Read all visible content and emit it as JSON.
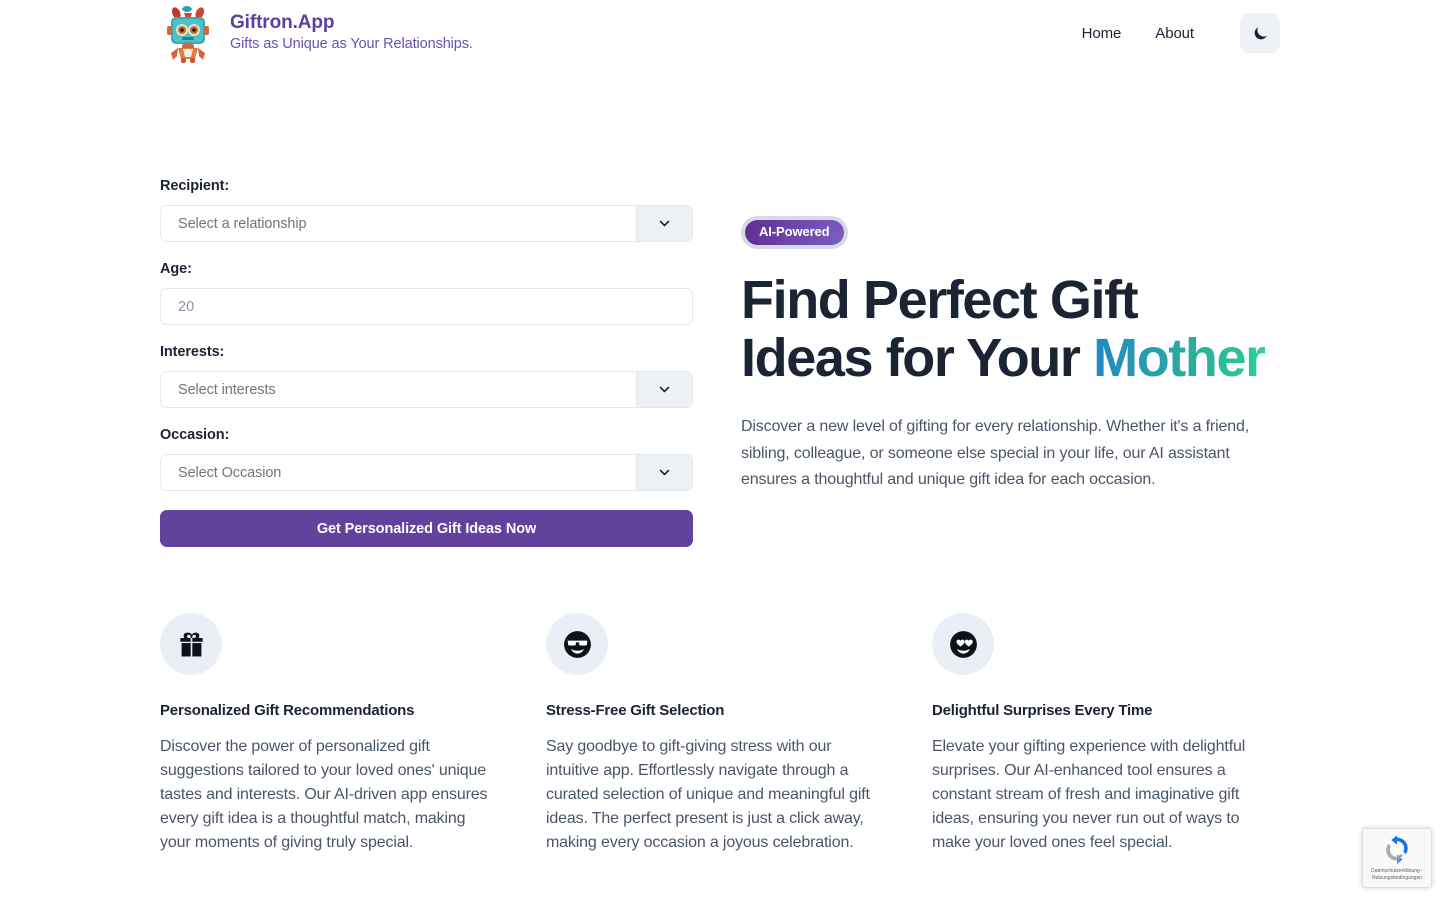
{
  "header": {
    "logo_icon": "giftron-robot-logo",
    "brand_title": "Giftron.App",
    "brand_tagline": "Gifts as Unique as Your Relationships.",
    "nav": [
      {
        "label": "Home",
        "name": "nav-link-home"
      },
      {
        "label": "About",
        "name": "nav-link-about"
      }
    ],
    "theme_toggle_icon": "moon-icon"
  },
  "form": {
    "recipient": {
      "label": "Recipient:",
      "placeholder": "Select a relationship",
      "value": "",
      "chevron_icon": "chevron-down-icon"
    },
    "age": {
      "label": "Age:",
      "placeholder": "20",
      "value": ""
    },
    "interests": {
      "label": "Interests:",
      "placeholder": "Select interests",
      "value": "",
      "chevron_icon": "chevron-down-icon"
    },
    "occasion": {
      "label": "Occasion:",
      "placeholder": "Select Occasion",
      "value": "",
      "chevron_icon": "chevron-down-icon"
    },
    "submit_label": "Get Personalized Gift Ideas Now"
  },
  "hero": {
    "badge": "AI-Powered",
    "title_lead": "Find Perfect Gift Ideas for Your ",
    "title_accent": "Mother",
    "description": "Discover a new level of gifting for every relationship. Whether it's a friend, sibling, colleague, or someone else special in your life, our AI assistant ensures a thoughtful and unique gift idea for each occasion."
  },
  "features": [
    {
      "icon": "gift-box-icon",
      "title": "Personalized Gift Recommendations",
      "description": "Discover the power of personalized gift suggestions tailored to your loved ones' unique tastes and interests. Our AI-driven app ensures every gift idea is a thoughtful match, making your moments of giving truly special."
    },
    {
      "icon": "smiley-sunglasses-icon",
      "title": "Stress-Free Gift Selection",
      "description": "Say goodbye to gift-giving stress with our intuitive app. Effortlessly navigate through a curated selection of unique and meaningful gift ideas. The perfect present is just a click away, making every occasion a joyous celebration."
    },
    {
      "icon": "smiley-heart-eyes-icon",
      "title": "Delightful Surprises Every Time",
      "description": "Elevate your gifting experience with delightful surprises. Our AI-enhanced tool ensures a constant stream of fresh and imaginative gift ideas, ensuring you never run out of ways to make your loved ones feel special."
    }
  ],
  "recaptcha": {
    "icon": "recaptcha-icon",
    "text": "Datenschutzerklärung - Nutzungsbedingungen"
  },
  "colors": {
    "brand_purple": "#5b3fa3",
    "button_purple": "#63429e",
    "accent_blue": "#2188c4",
    "accent_green": "#2ecf9a",
    "text_dark": "#1c2333",
    "text_muted": "#4b5668",
    "placeholder": "#8b94a6",
    "field_border": "#e3e8ef",
    "select_button_bg": "#edf1f6",
    "icon_circle_bg": "#eaeff5"
  }
}
